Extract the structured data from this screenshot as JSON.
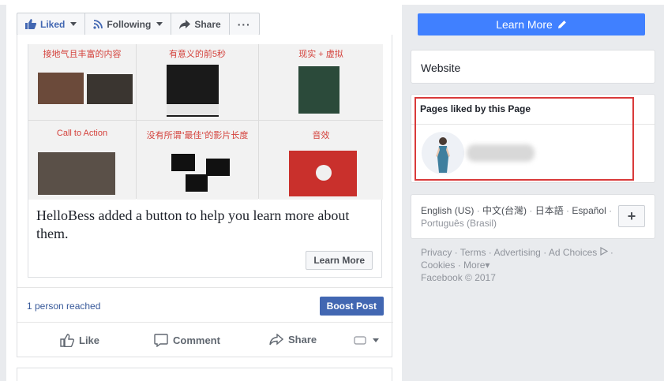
{
  "action_bar": {
    "liked_label": "Liked",
    "following_label": "Following",
    "share_label": "Share",
    "more_label": "···"
  },
  "attachment": {
    "cells": [
      {
        "title": "接地气且丰富的内容"
      },
      {
        "title": "有意义的前5秒"
      },
      {
        "title": "现实 + 虚拟"
      },
      {
        "title": "Call to Action"
      },
      {
        "title": "没有所谓\"最佳\"的影片长度"
      },
      {
        "title": "音效"
      }
    ],
    "text": "HelloBess added a button to help you learn more about them.",
    "button_label": "Learn More"
  },
  "reach": {
    "text": "1 person reached",
    "boost_label": "Boost Post"
  },
  "actions": {
    "like": "Like",
    "comment": "Comment",
    "share": "Share"
  },
  "sidebar": {
    "learn_more_label": "Learn More",
    "website_label": "Website",
    "pages_liked_title": "Pages liked by this Page",
    "languages": {
      "selected": "English (US)",
      "others": [
        "中文(台灣)",
        "日本語",
        "Español",
        "Português (Brasil)"
      ],
      "plus": "+"
    },
    "footer": {
      "privacy": "Privacy",
      "terms": "Terms",
      "advertising": "Advertising",
      "ad_choices": "Ad Choices",
      "cookies": "Cookies",
      "more": "More",
      "copyright": "Facebook © 2017"
    }
  },
  "colors": {
    "brand_blue": "#4267b2",
    "cta_blue": "#4080ff",
    "highlight_red": "#d93a3a",
    "link_blue": "#365899"
  }
}
